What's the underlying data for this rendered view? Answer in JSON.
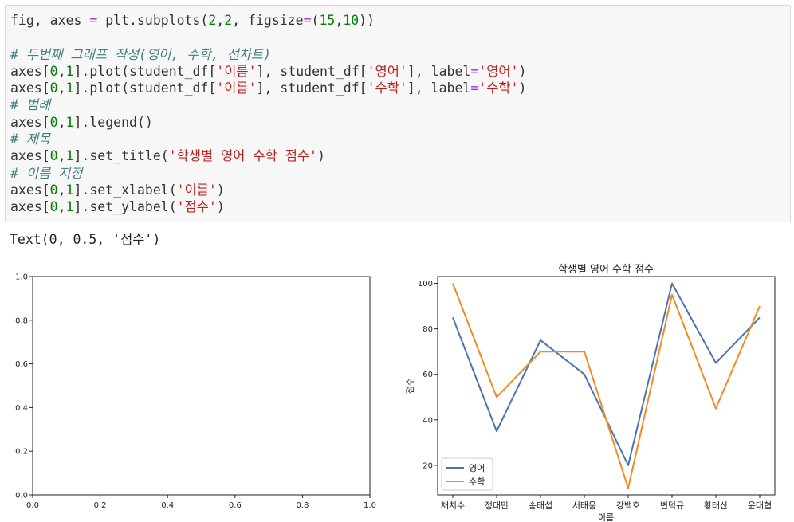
{
  "code_cell": {
    "lines": [
      [
        {
          "t": "fig, axes ",
          "c": ""
        },
        {
          "t": "=",
          "c": "op"
        },
        {
          "t": " plt.subplots(",
          "c": ""
        },
        {
          "t": "2",
          "c": "num"
        },
        {
          "t": ",",
          "c": ""
        },
        {
          "t": "2",
          "c": "num"
        },
        {
          "t": ", figsize",
          "c": ""
        },
        {
          "t": "=",
          "c": "op"
        },
        {
          "t": "(",
          "c": ""
        },
        {
          "t": "15",
          "c": "num"
        },
        {
          "t": ",",
          "c": ""
        },
        {
          "t": "10",
          "c": "num"
        },
        {
          "t": "))",
          "c": ""
        }
      ],
      [],
      [
        {
          "t": "# 두번째 그래프 작성(영어, 수학, 선차트)",
          "c": "cm"
        }
      ],
      [
        {
          "t": "axes[",
          "c": ""
        },
        {
          "t": "0",
          "c": "num"
        },
        {
          "t": ",",
          "c": ""
        },
        {
          "t": "1",
          "c": "num"
        },
        {
          "t": "].plot(student_df[",
          "c": ""
        },
        {
          "t": "'이름'",
          "c": "str"
        },
        {
          "t": "], student_df[",
          "c": ""
        },
        {
          "t": "'영어'",
          "c": "str"
        },
        {
          "t": "], label",
          "c": ""
        },
        {
          "t": "=",
          "c": "op"
        },
        {
          "t": "'영어'",
          "c": "str"
        },
        {
          "t": ")",
          "c": ""
        }
      ],
      [
        {
          "t": "axes[",
          "c": ""
        },
        {
          "t": "0",
          "c": "num"
        },
        {
          "t": ",",
          "c": ""
        },
        {
          "t": "1",
          "c": "num"
        },
        {
          "t": "].plot(student_df[",
          "c": ""
        },
        {
          "t": "'이름'",
          "c": "str"
        },
        {
          "t": "], student_df[",
          "c": ""
        },
        {
          "t": "'수학'",
          "c": "str"
        },
        {
          "t": "], label",
          "c": ""
        },
        {
          "t": "=",
          "c": "op"
        },
        {
          "t": "'수학'",
          "c": "str"
        },
        {
          "t": ")",
          "c": ""
        }
      ],
      [
        {
          "t": "# 범례",
          "c": "cm"
        }
      ],
      [
        {
          "t": "axes[",
          "c": ""
        },
        {
          "t": "0",
          "c": "num"
        },
        {
          "t": ",",
          "c": ""
        },
        {
          "t": "1",
          "c": "num"
        },
        {
          "t": "].legend()",
          "c": ""
        }
      ],
      [
        {
          "t": "# 제목",
          "c": "cm"
        }
      ],
      [
        {
          "t": "axes[",
          "c": ""
        },
        {
          "t": "0",
          "c": "num"
        },
        {
          "t": ",",
          "c": ""
        },
        {
          "t": "1",
          "c": "num"
        },
        {
          "t": "].set_title(",
          "c": ""
        },
        {
          "t": "'학생별 영어 수학 점수'",
          "c": "str"
        },
        {
          "t": ")",
          "c": ""
        }
      ],
      [
        {
          "t": "# 이름 지정",
          "c": "cm"
        }
      ],
      [
        {
          "t": "axes[",
          "c": ""
        },
        {
          "t": "0",
          "c": "num"
        },
        {
          "t": ",",
          "c": ""
        },
        {
          "t": "1",
          "c": "num"
        },
        {
          "t": "].set_xlabel(",
          "c": ""
        },
        {
          "t": "'이름'",
          "c": "str"
        },
        {
          "t": ")",
          "c": ""
        }
      ],
      [
        {
          "t": "axes[",
          "c": ""
        },
        {
          "t": "0",
          "c": "num"
        },
        {
          "t": ",",
          "c": ""
        },
        {
          "t": "1",
          "c": "num"
        },
        {
          "t": "].set_ylabel(",
          "c": ""
        },
        {
          "t": "'점수'",
          "c": "str"
        },
        {
          "t": ")",
          "c": ""
        }
      ]
    ]
  },
  "output": {
    "text": "Text(0, 0.5, '점수')"
  },
  "colors": {
    "series_1": "#4c72b0",
    "series_2": "#f08a24",
    "axes": "#222222"
  },
  "chart_data": [
    {
      "type": "line",
      "title": "",
      "xlabel": "",
      "ylabel": "",
      "xlim": [
        0.0,
        1.0
      ],
      "ylim": [
        0.0,
        1.0
      ],
      "xticks": [
        "0.0",
        "0.2",
        "0.4",
        "0.6",
        "0.8",
        "1.0"
      ],
      "yticks": [
        "0.0",
        "0.2",
        "0.4",
        "0.6",
        "0.8",
        "1.0"
      ],
      "series": []
    },
    {
      "type": "line",
      "title": "학생별 영어 수학 점수",
      "xlabel": "이름",
      "ylabel": "점수",
      "categories": [
        "채치수",
        "정대만",
        "송태섭",
        "서태웅",
        "강백호",
        "변덕규",
        "황태산",
        "윤대협"
      ],
      "ylim": [
        7,
        103
      ],
      "yticks": [
        20,
        40,
        60,
        80,
        100
      ],
      "legend": "lower-left",
      "series": [
        {
          "name": "영어",
          "values": [
            85,
            35,
            75,
            60,
            20,
            100,
            65,
            85
          ]
        },
        {
          "name": "수학",
          "values": [
            100,
            50,
            70,
            70,
            10,
            95,
            45,
            90
          ]
        }
      ]
    }
  ]
}
